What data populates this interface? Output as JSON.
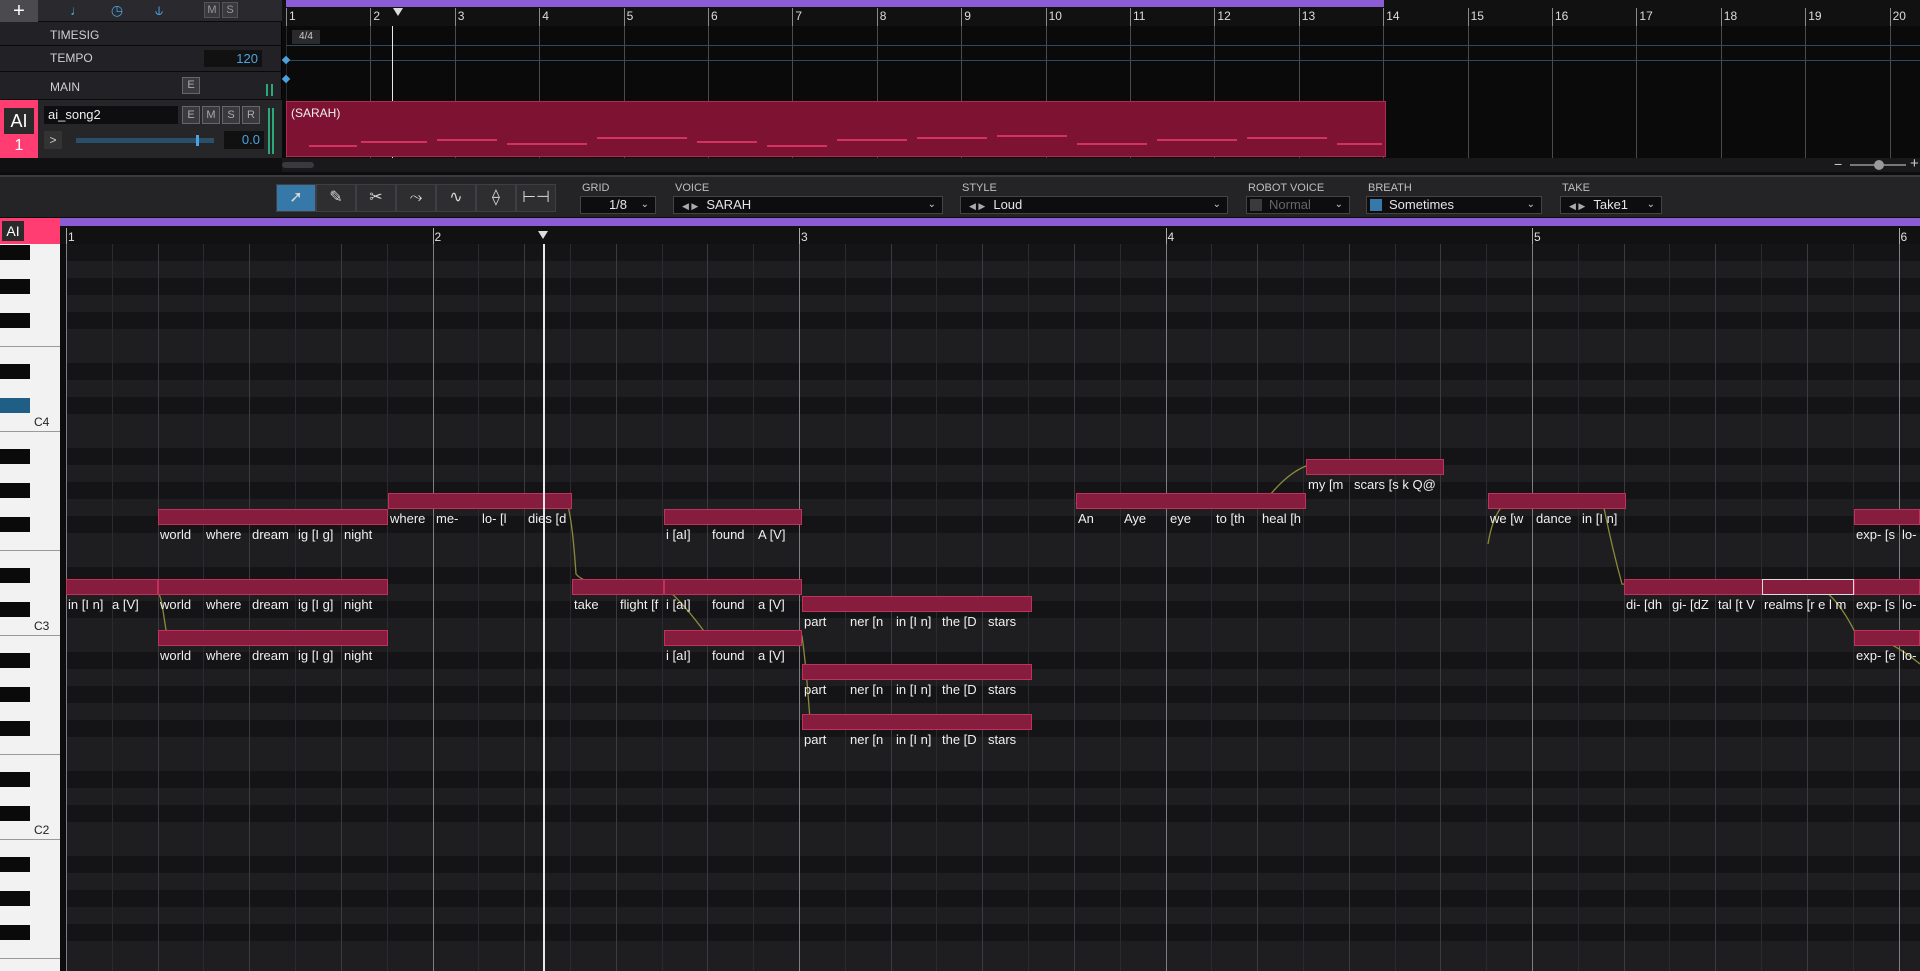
{
  "arrange": {
    "rows": [
      {
        "label": "TIMESIG",
        "value": "4/4"
      },
      {
        "label": "TEMPO",
        "value": "120"
      },
      {
        "label": "MAIN",
        "button": "E"
      }
    ],
    "ms_buttons": [
      "M",
      "S"
    ],
    "add_icon": "plus-icon",
    "tool_icons": [
      "note-icon",
      "clock-icon",
      "tuning-fork-icon"
    ],
    "ruler_bars": [
      "1",
      "2",
      "3",
      "4",
      "5",
      "6",
      "7",
      "8",
      "9",
      "10",
      "11",
      "12",
      "13",
      "14",
      "15",
      "16",
      "17",
      "18",
      "19",
      "20"
    ],
    "track": {
      "badge_top": "AI",
      "badge_num": "1",
      "name": "ai_song2",
      "buttons": [
        "E",
        "M",
        "S",
        "R"
      ],
      "volume_value": "0.0",
      "expand": ">",
      "clip_label": "(SARAH)"
    },
    "zoom_minus": "−",
    "zoom_plus": "+"
  },
  "toolbar": {
    "tools": [
      "select-tool-icon",
      "pencil-tool-icon",
      "scissors-tool-icon",
      "pitch-curve-tool-icon",
      "vibrato-tool-icon",
      "timing-tool-icon",
      "stretch-tool-icon"
    ],
    "grid": {
      "label": "GRID",
      "value": "1/8"
    },
    "voice": {
      "label": "VOICE",
      "value": "SARAH"
    },
    "style": {
      "label": "STYLE",
      "value": "Loud"
    },
    "robot": {
      "label": "ROBOT VOICE",
      "value": "Normal"
    },
    "breath": {
      "label": "BREATH",
      "value": "Sometimes"
    },
    "take": {
      "label": "TAKE",
      "value": "Take1"
    }
  },
  "pianoroll": {
    "ai_badge": "AI",
    "bar_numbers": [
      "1",
      "2",
      "3",
      "4",
      "5",
      "6"
    ],
    "key_labels": [
      "C4",
      "C3",
      "C2"
    ],
    "notes": [
      {
        "lyrics": [
          [
            "in [I n]",
            0
          ],
          [
            "a [V]",
            44
          ]
        ]
      },
      {
        "lyrics": [
          [
            "world",
            0
          ],
          [
            "where",
            46
          ],
          [
            "dream",
            92
          ],
          [
            "ig [I g]",
            138
          ],
          [
            "night",
            184
          ]
        ]
      },
      {
        "lyrics": [
          [
            "world",
            0
          ],
          [
            "where",
            46
          ],
          [
            "dream",
            92
          ],
          [
            "ig [I g]",
            138
          ],
          [
            "night",
            184
          ]
        ]
      },
      {
        "lyrics": [
          [
            "world",
            0
          ],
          [
            "where",
            46
          ],
          [
            "dream",
            92
          ],
          [
            "ig [I g]",
            138
          ],
          [
            "night",
            184
          ]
        ]
      },
      {
        "lyrics": [
          [
            "where",
            0
          ],
          [
            "me-",
            46
          ],
          [
            "lo- [l",
            92
          ],
          [
            "dies [d",
            138
          ]
        ]
      },
      {
        "lyrics": [
          [
            "take",
            0
          ],
          [
            "flight [f",
            46
          ]
        ]
      },
      {
        "lyrics": [
          [
            "i [aI]",
            0
          ],
          [
            "found",
            46
          ],
          [
            "A [V]",
            92
          ]
        ]
      },
      {
        "lyrics": [
          [
            "i [aI]",
            0
          ],
          [
            "found",
            46
          ],
          [
            "a [V]",
            92
          ]
        ]
      },
      {
        "lyrics": [
          [
            "i [aI]",
            0
          ],
          [
            "found",
            46
          ],
          [
            "a [V]",
            92
          ]
        ]
      },
      {
        "lyrics": [
          [
            "part",
            0
          ],
          [
            "ner [n",
            46
          ],
          [
            "in [I n]",
            92
          ],
          [
            "the [D",
            138
          ],
          [
            "stars",
            184
          ]
        ]
      },
      {
        "lyrics": [
          [
            "part",
            0
          ],
          [
            "ner [n",
            46
          ],
          [
            "in [I n]",
            92
          ],
          [
            "the [D",
            138
          ],
          [
            "stars",
            184
          ]
        ]
      },
      {
        "lyrics": [
          [
            "part",
            0
          ],
          [
            "ner [n",
            46
          ],
          [
            "in [I n]",
            92
          ],
          [
            "the [D",
            138
          ],
          [
            "stars",
            184
          ]
        ]
      },
      {
        "lyrics": [
          [
            "An",
            0
          ],
          [
            "Aye",
            46
          ],
          [
            "eye",
            92
          ],
          [
            "to [th",
            138
          ],
          [
            "heal [h",
            184
          ]
        ]
      },
      {
        "lyrics": [
          [
            "my [m",
            0
          ],
          [
            "scars [s k Q@",
            46
          ]
        ]
      },
      {
        "lyrics": [
          [
            "we [w",
            0
          ],
          [
            "dance",
            46
          ],
          [
            "in [I n]",
            92
          ]
        ]
      },
      {
        "lyrics": [
          [
            "di- [dh",
            0
          ],
          [
            "gi- [dZ",
            46
          ],
          [
            "tal [t V",
            92
          ]
        ]
      },
      {
        "lyrics": [
          [
            "realms [r e l m",
            0
          ]
        ]
      },
      {
        "lyrics": [
          [
            "exp- [s",
            0
          ],
          [
            "lo-",
            46
          ]
        ]
      },
      {
        "lyrics": [
          [
            "exp- [s",
            0
          ],
          [
            "lo-",
            46
          ]
        ]
      },
      {
        "lyrics": [
          [
            "exp- [e",
            0
          ],
          [
            "lo-",
            46
          ]
        ]
      }
    ]
  },
  "colors": {
    "accent": "#ff3d72",
    "note": "#861c3e",
    "purple": "#8b5cd6",
    "tool_active": "#3678a8"
  }
}
